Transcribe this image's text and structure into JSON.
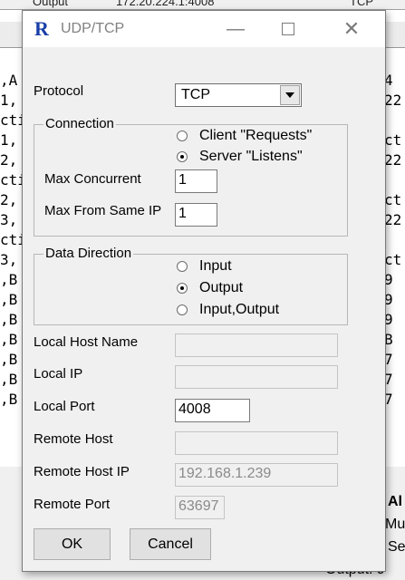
{
  "background": {
    "top_cells": [
      "Output",
      "172.20.224.1:4008",
      "TCP"
    ],
    "left_column": [
      ",A",
      "1,",
      "cti",
      "1,",
      "2,",
      "cti",
      "2,",
      "3,",
      "cti",
      "3,",
      ",B",
      ",B",
      ",B",
      ",B",
      ",B",
      ",B",
      ",B"
    ],
    "right_column": [
      "4",
      "22",
      "",
      "ct",
      "22",
      "",
      "ct",
      "22",
      "",
      "ct",
      "9",
      "9",
      "9",
      "B",
      "7",
      "7",
      "7"
    ],
    "bottom_right": [
      "Al",
      "Mu",
      "Se",
      "Output: 9"
    ]
  },
  "dialog": {
    "logo": "R",
    "title": "UDP/TCP",
    "protocol_label": "Protocol",
    "protocol_value": "TCP",
    "connection": {
      "legend": "Connection",
      "options": [
        "Client \"Requests\"",
        "Server \"Listens\""
      ],
      "selected": 1,
      "max_concurrent_label": "Max Concurrent",
      "max_concurrent_value": "1",
      "max_same_ip_label": "Max From Same IP",
      "max_same_ip_value": "1"
    },
    "data_direction": {
      "legend": "Data Direction",
      "options": [
        "Input",
        "Output",
        "Input,Output"
      ],
      "selected": 1
    },
    "local_host_name_label": "Local Host Name",
    "local_host_name_value": "",
    "local_ip_label": "Local IP",
    "local_ip_value": "",
    "local_port_label": "Local Port",
    "local_port_value": "4008",
    "remote_host_label": "Remote Host",
    "remote_host_value": "",
    "remote_host_ip_label": "Remote Host IP",
    "remote_host_ip_value": "192.168.1.239",
    "remote_port_label": "Remote Port",
    "remote_port_value": "63697",
    "ok_label": "OK",
    "cancel_label": "Cancel"
  }
}
